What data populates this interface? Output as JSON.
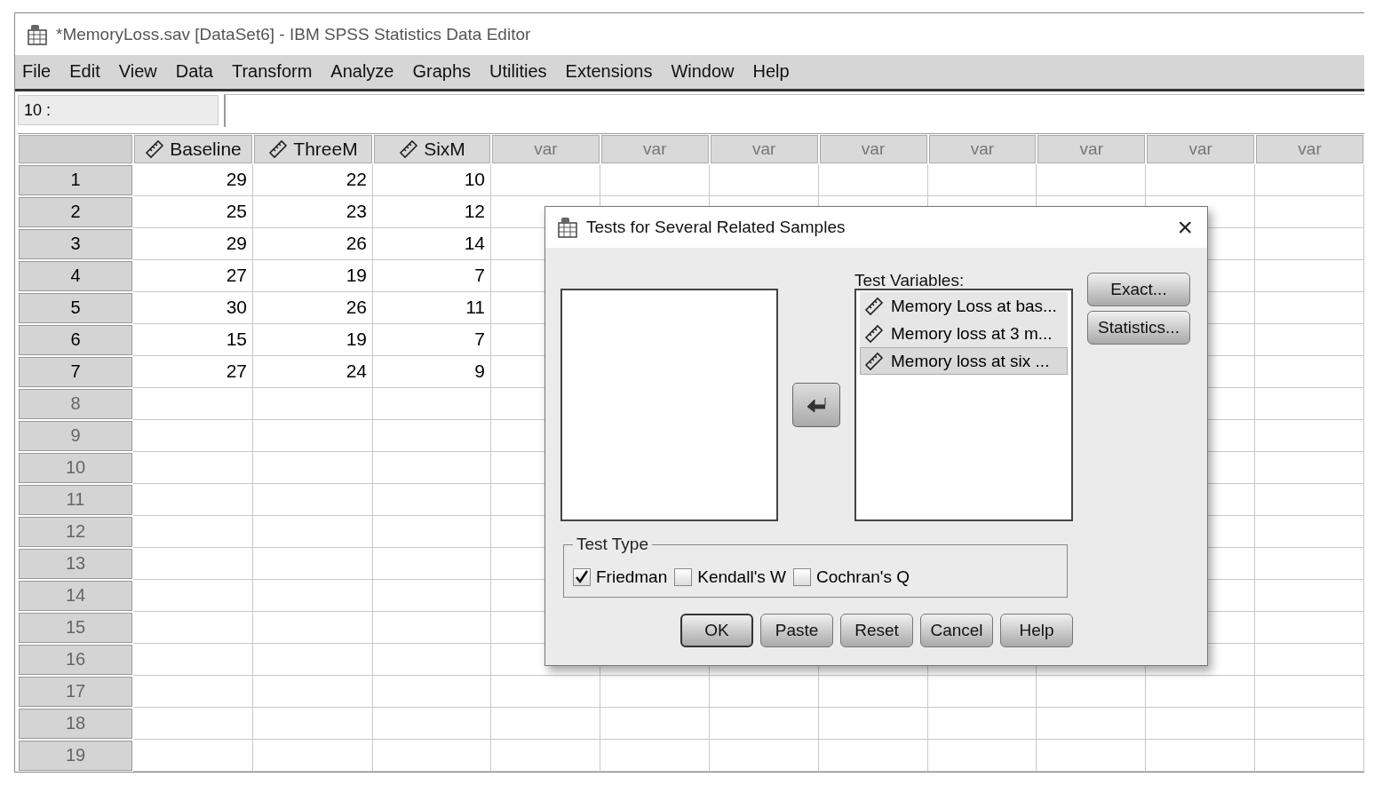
{
  "window": {
    "title": "*MemoryLoss.sav [DataSet6] - IBM SPSS Statistics Data Editor"
  },
  "menu": [
    "File",
    "Edit",
    "View",
    "Data",
    "Transform",
    "Analyze",
    "Graphs",
    "Utilities",
    "Extensions",
    "Window",
    "Help"
  ],
  "cell_editor": {
    "reference": "10 :"
  },
  "grid": {
    "columns": [
      {
        "label": "Baseline",
        "kind": "variable"
      },
      {
        "label": "ThreeM",
        "kind": "variable"
      },
      {
        "label": "SixM",
        "kind": "variable"
      },
      {
        "label": "var",
        "kind": "empty"
      },
      {
        "label": "var",
        "kind": "empty"
      },
      {
        "label": "var",
        "kind": "empty"
      },
      {
        "label": "var",
        "kind": "empty"
      },
      {
        "label": "var",
        "kind": "empty"
      },
      {
        "label": "var",
        "kind": "empty"
      },
      {
        "label": "var",
        "kind": "empty"
      },
      {
        "label": "var",
        "kind": "empty"
      }
    ],
    "rows": [
      {
        "number": "1",
        "values": [
          "29",
          "22",
          "10"
        ]
      },
      {
        "number": "2",
        "values": [
          "25",
          "23",
          "12"
        ]
      },
      {
        "number": "3",
        "values": [
          "29",
          "26",
          "14"
        ]
      },
      {
        "number": "4",
        "values": [
          "27",
          "19",
          "7"
        ]
      },
      {
        "number": "5",
        "values": [
          "30",
          "26",
          "11"
        ]
      },
      {
        "number": "6",
        "values": [
          "15",
          "19",
          "7"
        ]
      },
      {
        "number": "7",
        "values": [
          "27",
          "24",
          "9"
        ]
      },
      {
        "number": "8"
      },
      {
        "number": "9"
      },
      {
        "number": "10"
      },
      {
        "number": "11"
      },
      {
        "number": "12"
      },
      {
        "number": "13"
      },
      {
        "number": "14"
      },
      {
        "number": "15"
      },
      {
        "number": "16"
      },
      {
        "number": "17"
      },
      {
        "number": "18"
      },
      {
        "number": "19"
      }
    ]
  },
  "dialog": {
    "title": "Tests for Several Related Samples",
    "close": "×",
    "test_variables_label": "Test Variables:",
    "test_variables": [
      {
        "label": "Memory Loss at bas...",
        "selected": false
      },
      {
        "label": "Memory loss at 3 m...",
        "selected": false
      },
      {
        "label": "Memory loss at six ...",
        "selected": true
      }
    ],
    "side_buttons": [
      "Exact...",
      "Statistics..."
    ],
    "test_type": {
      "title": "Test Type",
      "options": [
        {
          "label": "Friedman",
          "checked": true
        },
        {
          "label": "Kendall's W",
          "checked": false
        },
        {
          "label": "Cochran's Q",
          "checked": false
        }
      ]
    },
    "buttons": [
      {
        "label": "OK",
        "default": true
      },
      {
        "label": "Paste",
        "default": false
      },
      {
        "label": "Reset",
        "default": false
      },
      {
        "label": "Cancel",
        "default": false
      },
      {
        "label": "Help",
        "default": false
      }
    ]
  }
}
